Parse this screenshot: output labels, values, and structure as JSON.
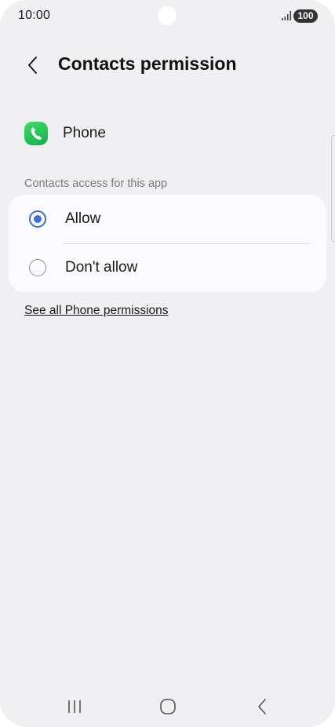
{
  "status_bar": {
    "time": "10:00",
    "battery": "100",
    "signal_icon": "signal-icon"
  },
  "header": {
    "back_icon": "chevron-left-icon",
    "title": "Contacts permission"
  },
  "app": {
    "icon": "phone-app-icon",
    "name": "Phone",
    "icon_color": "#1fc455"
  },
  "permission": {
    "section_label": "Contacts access for this app",
    "options": [
      {
        "label": "Allow",
        "selected": true
      },
      {
        "label": "Don't allow",
        "selected": false
      }
    ],
    "accent_color": "#3e6ed8"
  },
  "links": {
    "see_all": "See all Phone permissions"
  },
  "nav_bar": {
    "recents_icon": "recents-icon",
    "home_icon": "home-icon",
    "back_icon": "back-icon"
  }
}
